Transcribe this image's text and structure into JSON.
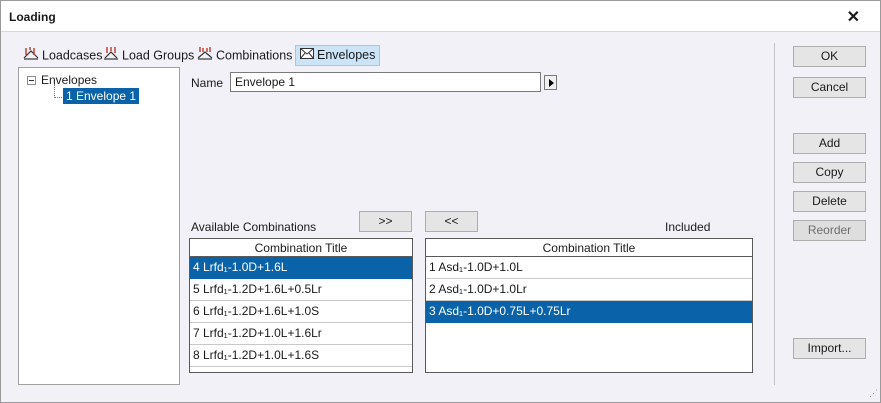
{
  "window": {
    "title": "Loading",
    "close_glyph": "✕"
  },
  "tabs": [
    {
      "label": "Loadcases",
      "icon": "loadcases-icon",
      "active": false
    },
    {
      "label": "Load Groups",
      "icon": "load-groups-icon",
      "active": false
    },
    {
      "label": "Combinations",
      "icon": "combinations-icon",
      "active": false
    },
    {
      "label": "Envelopes",
      "icon": "envelope-icon",
      "active": true
    }
  ],
  "tree": {
    "root_label": "Envelopes",
    "children": [
      {
        "label": "1 Envelope 1",
        "selected": true
      }
    ]
  },
  "form": {
    "name_label": "Name",
    "name_value": "Envelope 1"
  },
  "available": {
    "label": "Available Combinations",
    "header": "Combination Title",
    "rows": [
      {
        "text": "4 Lrfd₁-1.0D+1.6L",
        "selected": true
      },
      {
        "text": "5 Lrfd₁-1.2D+1.6L+0.5Lr",
        "selected": false
      },
      {
        "text": "6 Lrfd₁-1.2D+1.6L+1.0S",
        "selected": false
      },
      {
        "text": "7 Lrfd₁-1.2D+1.0L+1.6Lr",
        "selected": false
      },
      {
        "text": "8 Lrfd₁-1.2D+1.0L+1.6S",
        "selected": false
      }
    ]
  },
  "included": {
    "label": "Included",
    "header": "Combination Title",
    "rows": [
      {
        "text": "1 Asd₁-1.0D+1.0L",
        "selected": false
      },
      {
        "text": "2 Asd₁-1.0D+1.0Lr",
        "selected": false
      },
      {
        "text": "3 Asd₁-1.0D+0.75L+0.75Lr",
        "selected": true
      }
    ]
  },
  "transfer": {
    "add_all_label": ">>",
    "remove_label": "<<"
  },
  "buttons": {
    "ok": "OK",
    "cancel": "Cancel",
    "add": "Add",
    "copy": "Copy",
    "delete": "Delete",
    "reorder": "Reorder",
    "import": "Import..."
  },
  "colors": {
    "selection": "#0a63a8",
    "active_tab": "#cce4f7",
    "dialog_bg": "#f2f1f7"
  }
}
